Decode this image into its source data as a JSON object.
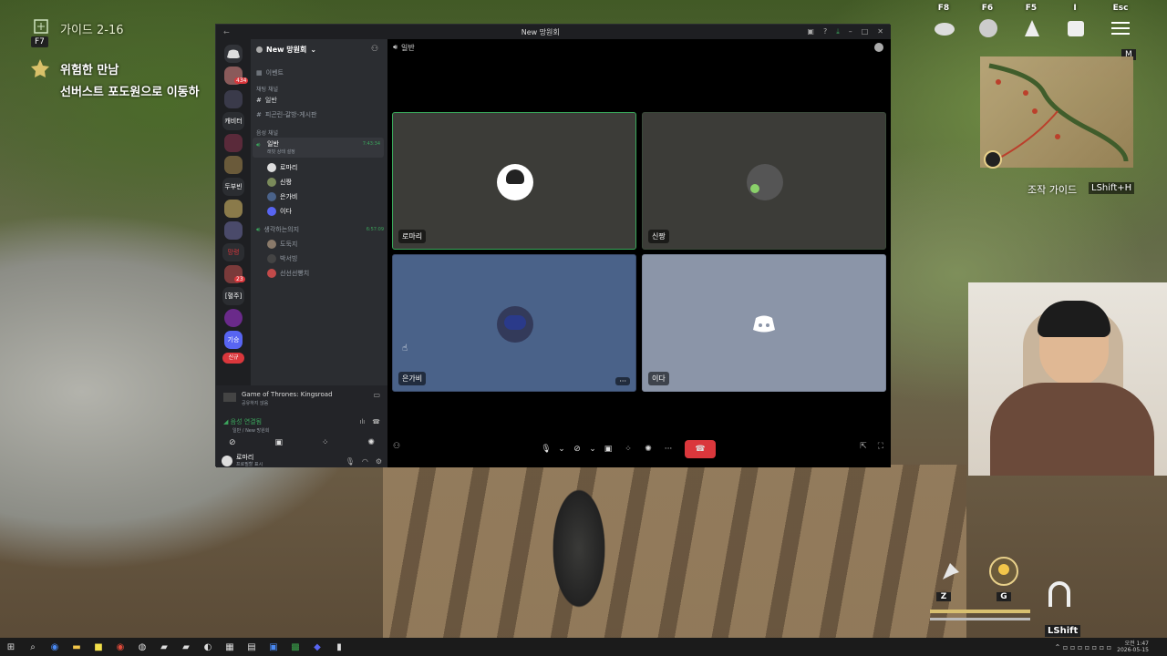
{
  "game": {
    "guide_label": "가이드 2-16",
    "guide_key": "F7",
    "quest_title": "위험한 만남",
    "quest_desc": "선버스트 포도원으로 이동하",
    "top_keys": [
      "F8",
      "F6",
      "F5",
      "I",
      "Esc"
    ],
    "map_key": "M",
    "control_guide": "조작 가이드",
    "control_guide_key": "LShift+H",
    "bottom_keys": [
      "Z",
      "G"
    ],
    "sprint_key": "LShift"
  },
  "discord": {
    "window_title": "New 망원회",
    "server_name": "New 망원회",
    "events": "이벤트",
    "text_category": "채팅 채널",
    "text_channels": [
      "일반",
      "피곤린-갈방-게시판"
    ],
    "voice_category": "음성 채널",
    "voice_channel": "일반",
    "voice_channel_sub": "래빗 상태 설정",
    "voice_channel_time": "7:43:34",
    "voice_members": [
      "로마리",
      "신짱",
      "은가비",
      "이다"
    ],
    "voice_channel2": "생각하는의지",
    "voice_channel2_time": "6:57:09",
    "voice_members2": [
      "도둑지",
      "박서빙",
      "선선선빵치"
    ],
    "server_badges": [
      "434",
      "23"
    ],
    "server_labels": [
      "캐비터",
      "두부빈",
      "망령",
      "[혈주]",
      "기승",
      "신규"
    ],
    "activity_title": "Game of Thrones: Kingsroad",
    "activity_sub": "공유하지 않음",
    "voice_connected": "음성 연결됨",
    "voice_connected_sub": "일반 / New 망원회",
    "user_name": "로마리",
    "user_status": "프로필할 표시",
    "stage_channel": "일반",
    "tiles": [
      {
        "name": "로마리",
        "bg": "#3c3c38"
      },
      {
        "name": "신짱",
        "bg": "#3c3c38"
      },
      {
        "name": "은가비",
        "bg": "#4a6289"
      },
      {
        "name": "이다",
        "bg": "#8b95a8"
      }
    ],
    "colors": {
      "accent": "#5865f2",
      "speaking": "#38a85a",
      "hangup": "#da373c"
    }
  },
  "taskbar": {
    "time": "오전 1:47",
    "date": "2026-05-15"
  }
}
